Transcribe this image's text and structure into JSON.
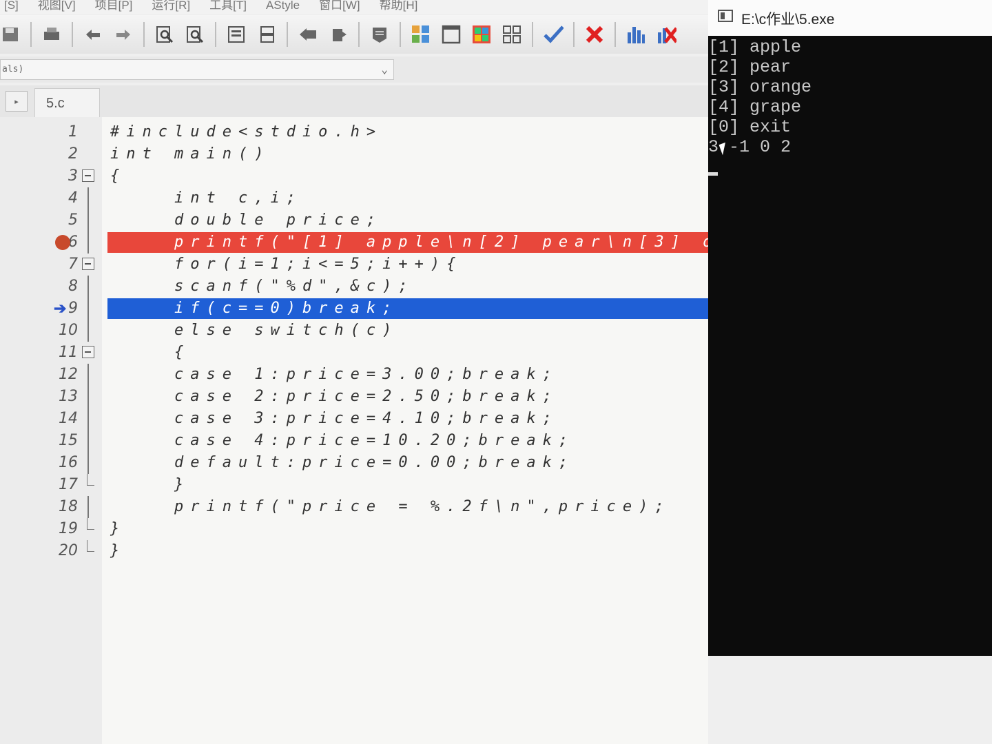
{
  "menu": [
    "[S]",
    "视图[V]",
    "项目[P]",
    "运行[R]",
    "工具[T]",
    "AStyle",
    "窗口[W]",
    "帮助[H]"
  ],
  "combo": {
    "value": "als)"
  },
  "tab": {
    "label": "5.c",
    "nav": "▸"
  },
  "editor": {
    "lines": [
      {
        "n": "1",
        "text": "#include<stdio.h>"
      },
      {
        "n": "2",
        "text": "int main()"
      },
      {
        "n": "3",
        "text": "{"
      },
      {
        "n": "4",
        "text": "    int c,i;"
      },
      {
        "n": "5",
        "text": "    double price;"
      },
      {
        "n": "6",
        "text": "    printf(\"[1] apple\\n[2] pear\\n[3] o"
      },
      {
        "n": "7",
        "text": "    for(i=1;i<=5;i++){"
      },
      {
        "n": "8",
        "text": "    scanf(\"%d\",&c);"
      },
      {
        "n": "9",
        "text": "    if(c==0)break;"
      },
      {
        "n": "10",
        "text": "    else switch(c)"
      },
      {
        "n": "11",
        "text": "    {"
      },
      {
        "n": "12",
        "text": "    case 1:price=3.00;break;"
      },
      {
        "n": "13",
        "text": "    case 2:price=2.50;break;"
      },
      {
        "n": "14",
        "text": "    case 3:price=4.10;break;"
      },
      {
        "n": "15",
        "text": "    case 4:price=10.20;break;"
      },
      {
        "n": "16",
        "text": "    default:price=0.00;break;"
      },
      {
        "n": "17",
        "text": "    }"
      },
      {
        "n": "18",
        "text": "    printf(\"price = %.2f\\n\",price);"
      },
      {
        "n": "19",
        "text": "}"
      },
      {
        "n": "20",
        "text": "}"
      }
    ],
    "breakpoint_line": "6",
    "current_line": "9",
    "colors": {
      "breakpoint": "#e8473b",
      "current": "#1f5fd6"
    }
  },
  "console": {
    "title": "E:\\c作业\\5.exe",
    "lines": [
      "[1] apple",
      "[2] pear",
      "[3] orange",
      "[4] grape",
      "[0] exit",
      "3 -1 0 2"
    ]
  }
}
